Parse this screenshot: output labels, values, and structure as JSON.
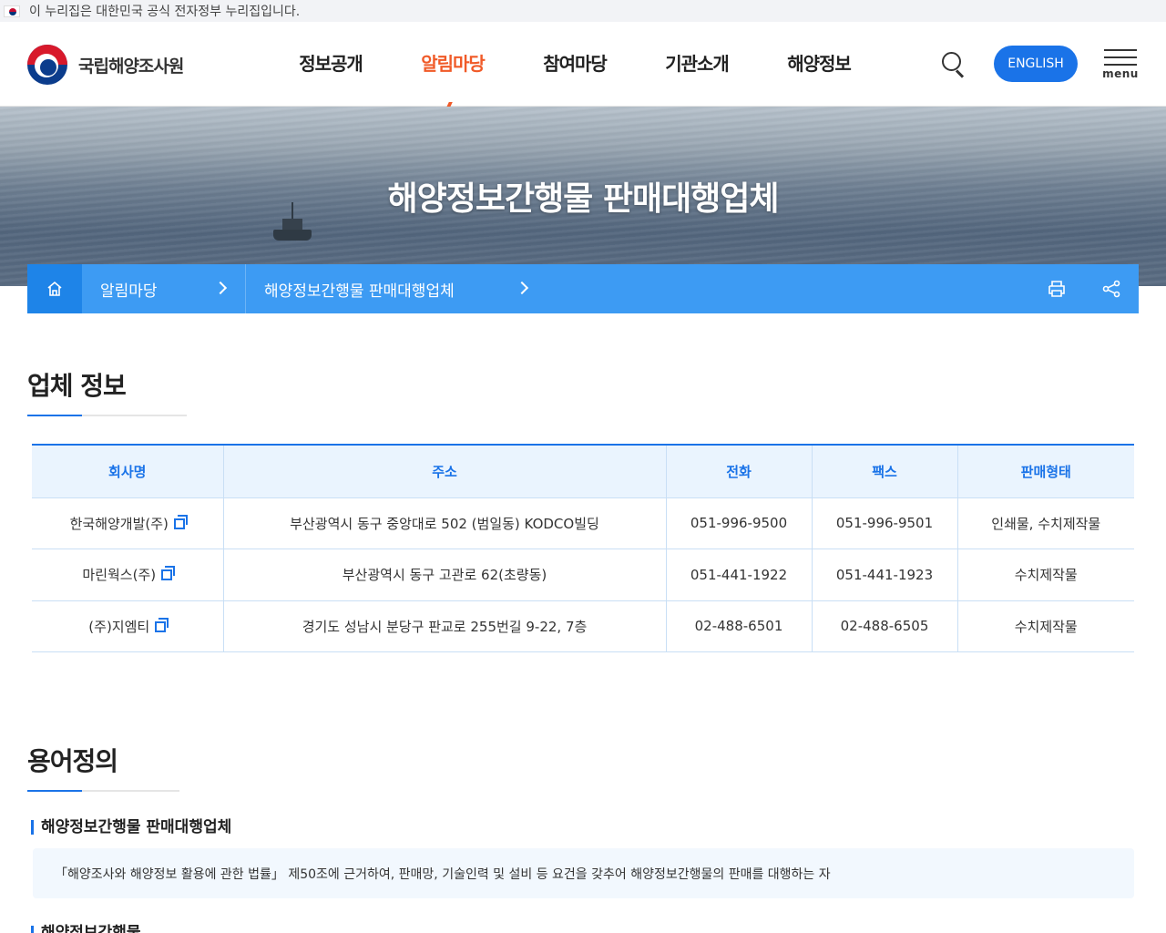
{
  "gov_notice": "이 누리집은 대한민국 공식 전자정부 누리집입니다.",
  "logo": {
    "name": "국립해양조사원"
  },
  "nav": {
    "items": [
      {
        "label": "정보공개",
        "active": false
      },
      {
        "label": "알림마당",
        "active": true
      },
      {
        "label": "참여마당",
        "active": false
      },
      {
        "label": "기관소개",
        "active": false
      },
      {
        "label": "해양정보",
        "active": false
      }
    ],
    "english_label": "ENGLISH",
    "menu_label": "menu"
  },
  "hero": {
    "title": "해양정보간행물 판매대행업체"
  },
  "breadcrumb": {
    "home_icon": "home-icon",
    "items": [
      "알림마당",
      "해양정보간행물 판매대행업체"
    ],
    "tools": [
      "print-icon",
      "share-icon"
    ]
  },
  "company_section": {
    "title": "업체 정보",
    "columns": [
      "회사명",
      "주소",
      "전화",
      "팩스",
      "판매형태"
    ],
    "rows": [
      {
        "name": "한국해양개발(주)",
        "address": "부산광역시 동구 중앙대로 502 (범일동) KODCO빌딩",
        "phone": "051-996-9500",
        "fax": "051-996-9501",
        "type": "인쇄물, 수치제작물"
      },
      {
        "name": "마린웍스(주)",
        "address": "부산광역시 동구 고관로 62(초량동)",
        "phone": "051-441-1922",
        "fax": "051-441-1923",
        "type": "수치제작물"
      },
      {
        "name": "(주)지엠티",
        "address": "경기도 성남시 분당구 판교로 255번길 9-22, 7층",
        "phone": "02-488-6501",
        "fax": "02-488-6505",
        "type": "수치제작물"
      }
    ]
  },
  "terms_section": {
    "title": "용어정의",
    "items": [
      {
        "term": "해양정보간행물 판매대행업체",
        "definition": "「해양조사와 해양정보 활용에 관한 법률」 제50조에 근거하여, 판매망, 기술인력 및 설비 등 요건을 갖추어 해양정보간행물의 판매를 대행하는 자"
      },
      {
        "term": "해양정보간행물"
      }
    ]
  },
  "colors": {
    "accent": "#1a73e8",
    "breadcrumb": "#3d9bf3",
    "active_nav": "#f05a28"
  }
}
